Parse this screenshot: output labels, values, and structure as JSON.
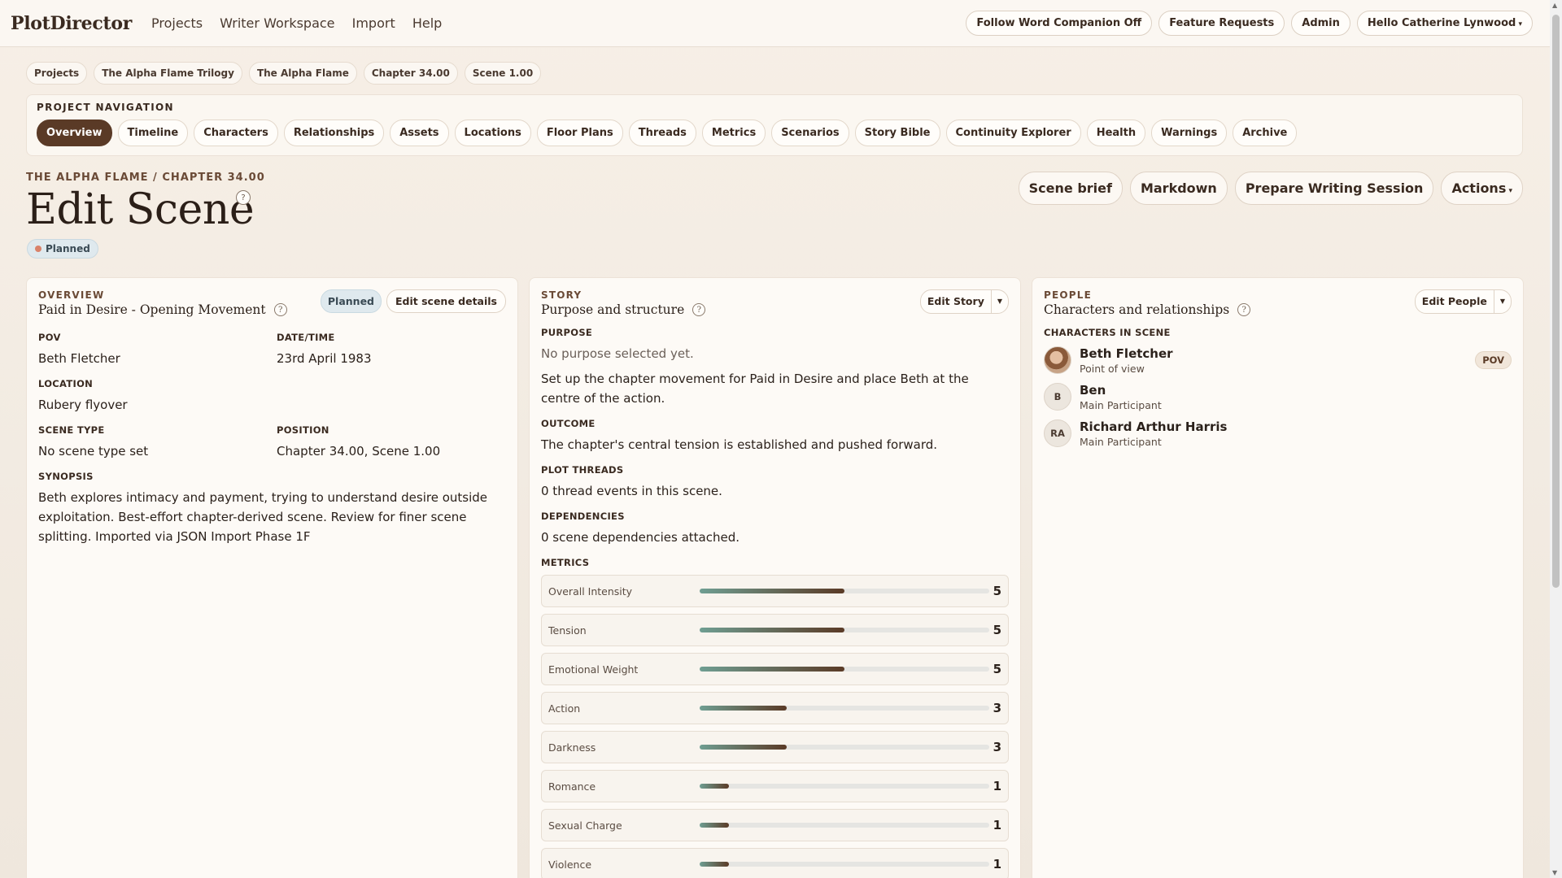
{
  "app": {
    "brand": "PlotDirector",
    "nav": [
      "Projects",
      "Writer Workspace",
      "Import",
      "Help"
    ],
    "right_buttons": {
      "follow": "Follow Word Companion Off",
      "feature": "Feature Requests",
      "admin": "Admin",
      "user": "Hello Catherine Lynwood"
    }
  },
  "breadcrumbs": [
    "Projects",
    "The Alpha Flame Trilogy",
    "The Alpha Flame",
    "Chapter 34.00",
    "Scene 1.00"
  ],
  "project_nav": {
    "label": "PROJECT NAVIGATION",
    "tabs": [
      "Overview",
      "Timeline",
      "Characters",
      "Relationships",
      "Assets",
      "Locations",
      "Floor Plans",
      "Threads",
      "Metrics",
      "Scenarios",
      "Story Bible",
      "Continuity Explorer",
      "Health",
      "Warnings",
      "Archive"
    ],
    "active": "Overview"
  },
  "page": {
    "subhead": "THE ALPHA FLAME / CHAPTER 34.00",
    "title": "Edit Scene",
    "help": "?",
    "status": "Planned",
    "actions": {
      "brief": "Scene brief",
      "markdown": "Markdown",
      "prepare": "Prepare Writing Session",
      "actions": "Actions"
    }
  },
  "overview": {
    "eyebrow": "OVERVIEW",
    "title": "Paid in Desire - Opening Movement",
    "status_chip": "Planned",
    "edit_button": "Edit scene details",
    "pov_label": "POV",
    "pov": "Beth Fletcher",
    "datetime_label": "DATE/TIME",
    "datetime": "23rd April 1983",
    "location_label": "LOCATION",
    "location": "Rubery flyover",
    "scene_type_label": "SCENE TYPE",
    "scene_type": "No scene type set",
    "position_label": "POSITION",
    "position": "Chapter 34.00, Scene 1.00",
    "synopsis_label": "SYNOPSIS",
    "synopsis": "Beth explores intimacy and payment, trying to understand desire outside exploitation. Best-effort chapter-derived scene. Review for finer scene splitting. Imported via JSON Import Phase 1F"
  },
  "story": {
    "eyebrow": "STORY",
    "title": "Purpose and structure",
    "edit_button": "Edit Story",
    "purpose_label": "PURPOSE",
    "purpose_none": "No purpose selected yet.",
    "purpose_text": "Set up the chapter movement for Paid in Desire and place Beth at the centre of the action.",
    "outcome_label": "OUTCOME",
    "outcome": "The chapter's central tension is established and pushed forward.",
    "threads_label": "PLOT THREADS",
    "threads": "0 thread events in this scene.",
    "deps_label": "DEPENDENCIES",
    "deps": "0 scene dependencies attached.",
    "metrics_label": "METRICS",
    "metrics": [
      {
        "name": "Overall Intensity",
        "value": 5,
        "max": 10
      },
      {
        "name": "Tension",
        "value": 5,
        "max": 10
      },
      {
        "name": "Emotional Weight",
        "value": 5,
        "max": 10
      },
      {
        "name": "Action",
        "value": 3,
        "max": 10
      },
      {
        "name": "Darkness",
        "value": 3,
        "max": 10
      },
      {
        "name": "Romance",
        "value": 1,
        "max": 10
      },
      {
        "name": "Sexual Charge",
        "value": 1,
        "max": 10
      },
      {
        "name": "Violence",
        "value": 1,
        "max": 10
      }
    ]
  },
  "people": {
    "eyebrow": "PEOPLE",
    "title": "Characters and relationships",
    "edit_button": "Edit People",
    "chars_label": "CHARACTERS IN SCENE",
    "characters": [
      {
        "initials": "",
        "name": "Beth Fletcher",
        "role": "Point of view",
        "badge": "POV"
      },
      {
        "initials": "B",
        "name": "Ben",
        "role": "Main Participant",
        "badge": ""
      },
      {
        "initials": "RA",
        "name": "Richard Arthur Harris",
        "role": "Main Participant",
        "badge": ""
      }
    ]
  }
}
